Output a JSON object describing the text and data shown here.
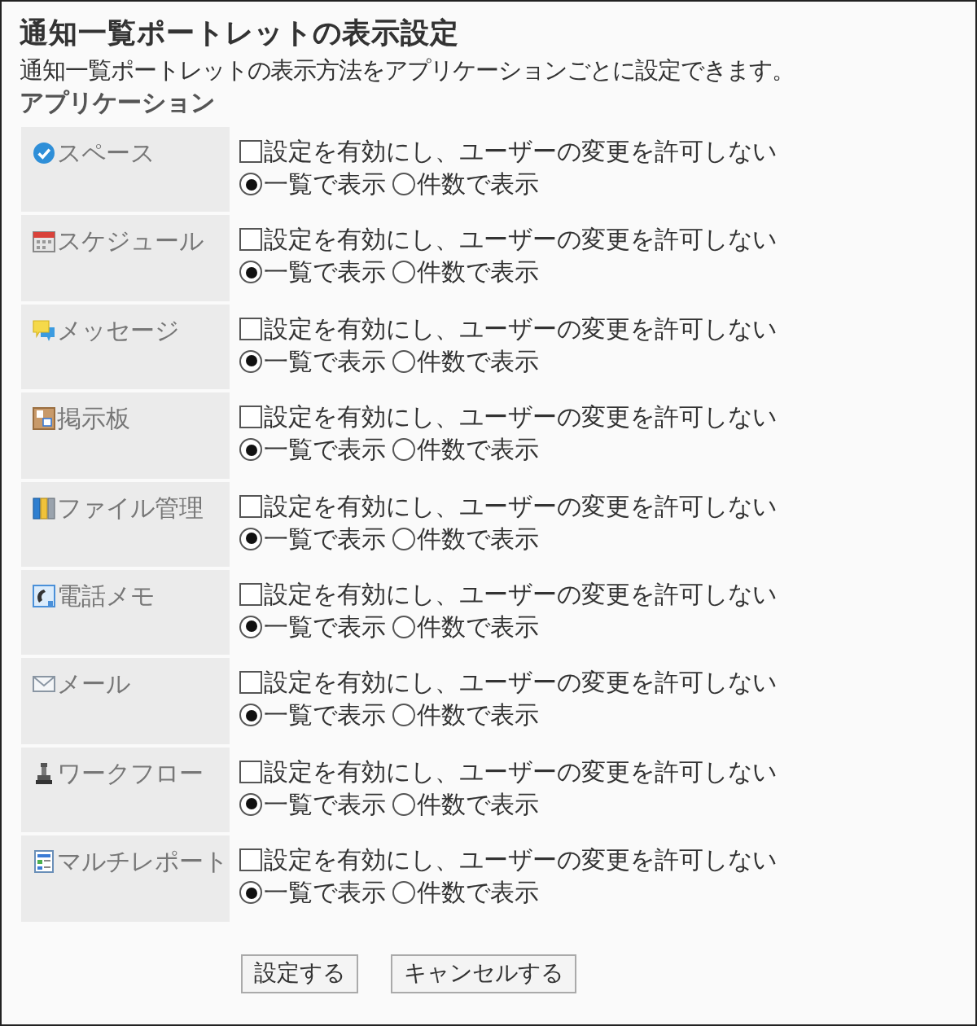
{
  "title": "通知一覧ポートレットの表示設定",
  "description": "通知一覧ポートレットの表示方法をアプリケーションごとに設定できます。",
  "section_label": "アプリケーション",
  "applications": [
    {
      "name": "スペース",
      "kind": "space",
      "lock_option": {
        "label": "設定を有効にし、ユーザーの変更を許可しない",
        "checked": false
      },
      "display_options": [
        {
          "label": "一覧で表示",
          "selected": true
        },
        {
          "label": "件数で表示",
          "selected": false
        }
      ]
    },
    {
      "name": "スケジュール",
      "kind": "schedule",
      "lock_option": {
        "label": "設定を有効にし、ユーザーの変更を許可しない",
        "checked": false
      },
      "display_options": [
        {
          "label": "一覧で表示",
          "selected": true
        },
        {
          "label": "件数で表示",
          "selected": false
        }
      ]
    },
    {
      "name": "メッセージ",
      "kind": "message",
      "lock_option": {
        "label": "設定を有効にし、ユーザーの変更を許可しない",
        "checked": false
      },
      "display_options": [
        {
          "label": "一覧で表示",
          "selected": true
        },
        {
          "label": "件数で表示",
          "selected": false
        }
      ]
    },
    {
      "name": "掲示板",
      "kind": "bulletin",
      "lock_option": {
        "label": "設定を有効にし、ユーザーの変更を許可しない",
        "checked": false
      },
      "display_options": [
        {
          "label": "一覧で表示",
          "selected": true
        },
        {
          "label": "件数で表示",
          "selected": false
        }
      ]
    },
    {
      "name": "ファイル管理",
      "kind": "file",
      "lock_option": {
        "label": "設定を有効にし、ユーザーの変更を許可しない",
        "checked": false
      },
      "display_options": [
        {
          "label": "一覧で表示",
          "selected": true
        },
        {
          "label": "件数で表示",
          "selected": false
        }
      ]
    },
    {
      "name": "電話メモ",
      "kind": "phone",
      "lock_option": {
        "label": "設定を有効にし、ユーザーの変更を許可しない",
        "checked": false
      },
      "display_options": [
        {
          "label": "一覧で表示",
          "selected": true
        },
        {
          "label": "件数で表示",
          "selected": false
        }
      ]
    },
    {
      "name": "メール",
      "kind": "mail",
      "lock_option": {
        "label": "設定を有効にし、ユーザーの変更を許可しない",
        "checked": false
      },
      "display_options": [
        {
          "label": "一覧で表示",
          "selected": true
        },
        {
          "label": "件数で表示",
          "selected": false
        }
      ]
    },
    {
      "name": "ワークフロー",
      "kind": "workflow",
      "lock_option": {
        "label": "設定を有効にし、ユーザーの変更を許可しない",
        "checked": false
      },
      "display_options": [
        {
          "label": "一覧で表示",
          "selected": true
        },
        {
          "label": "件数で表示",
          "selected": false
        }
      ]
    },
    {
      "name": "マルチレポート",
      "kind": "report",
      "lock_option": {
        "label": "設定を有効にし、ユーザーの変更を許可しない",
        "checked": false
      },
      "display_options": [
        {
          "label": "一覧で表示",
          "selected": true
        },
        {
          "label": "件数で表示",
          "selected": false
        }
      ]
    }
  ],
  "buttons": [
    {
      "label": "設定する"
    },
    {
      "label": "キャンセルする"
    }
  ]
}
